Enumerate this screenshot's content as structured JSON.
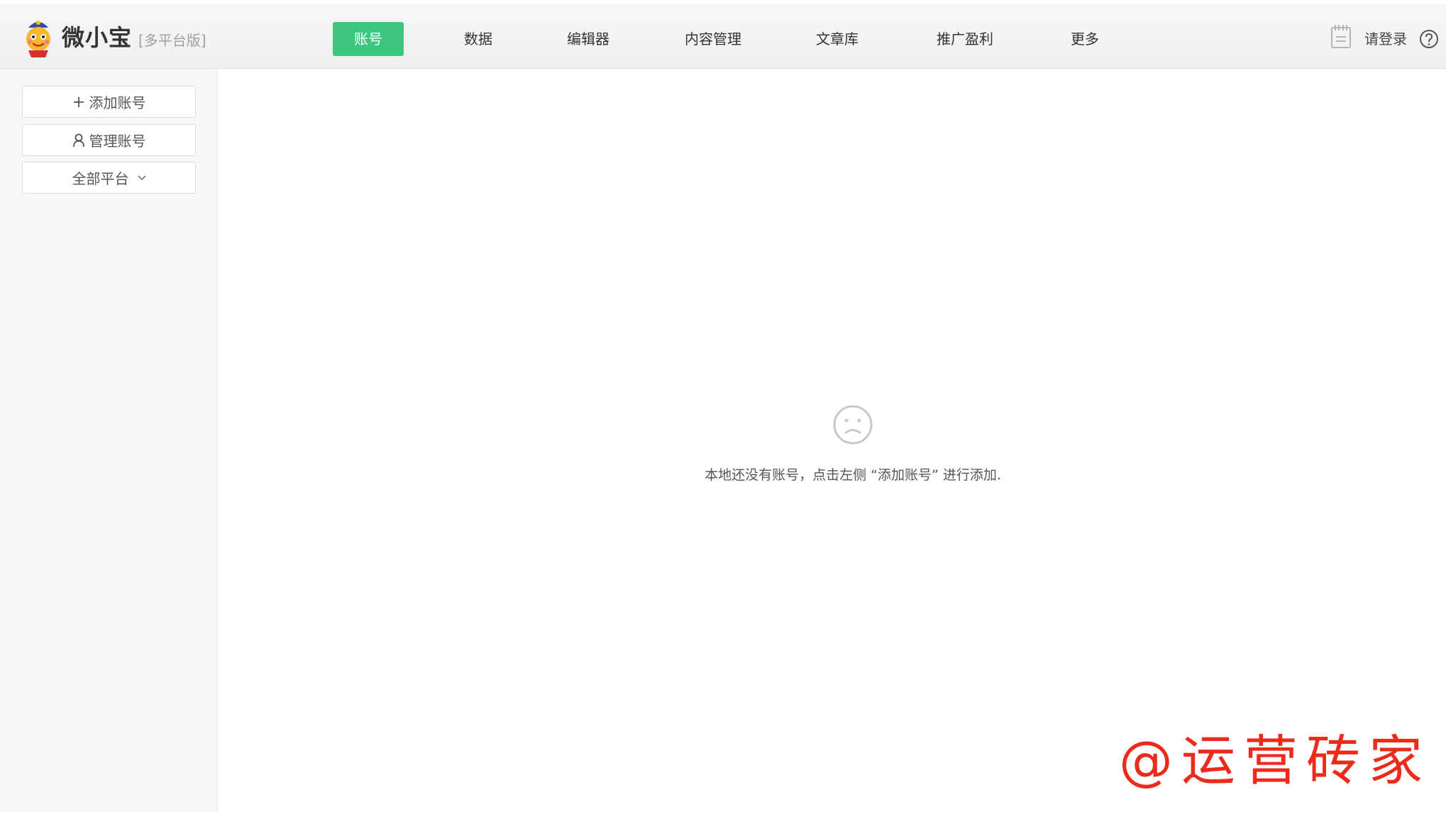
{
  "header": {
    "brand_name": "微小宝",
    "brand_edition": "[多平台版]",
    "tabs": [
      {
        "label": "账号",
        "active": true
      },
      {
        "label": "数据",
        "active": false
      },
      {
        "label": "编辑器",
        "active": false
      },
      {
        "label": "内容管理",
        "active": false
      },
      {
        "label": "文章库",
        "active": false
      },
      {
        "label": "推广盈利",
        "active": false
      },
      {
        "label": "更多",
        "active": false
      }
    ],
    "login_label": "请登录",
    "calendar_icon": "calendar-icon",
    "help_icon": "help-icon"
  },
  "sidebar": {
    "add_account_label": "添加账号",
    "manage_account_label": "管理账号",
    "platform_filter_label": "全部平台"
  },
  "main": {
    "empty_message": "本地还没有账号，点击左侧 “添加账号” 进行添加.",
    "empty_icon": "sad-face-icon"
  },
  "watermark": "@运营砖家",
  "colors": {
    "accent": "#3ec57f",
    "watermark": "#ee2a1b"
  }
}
